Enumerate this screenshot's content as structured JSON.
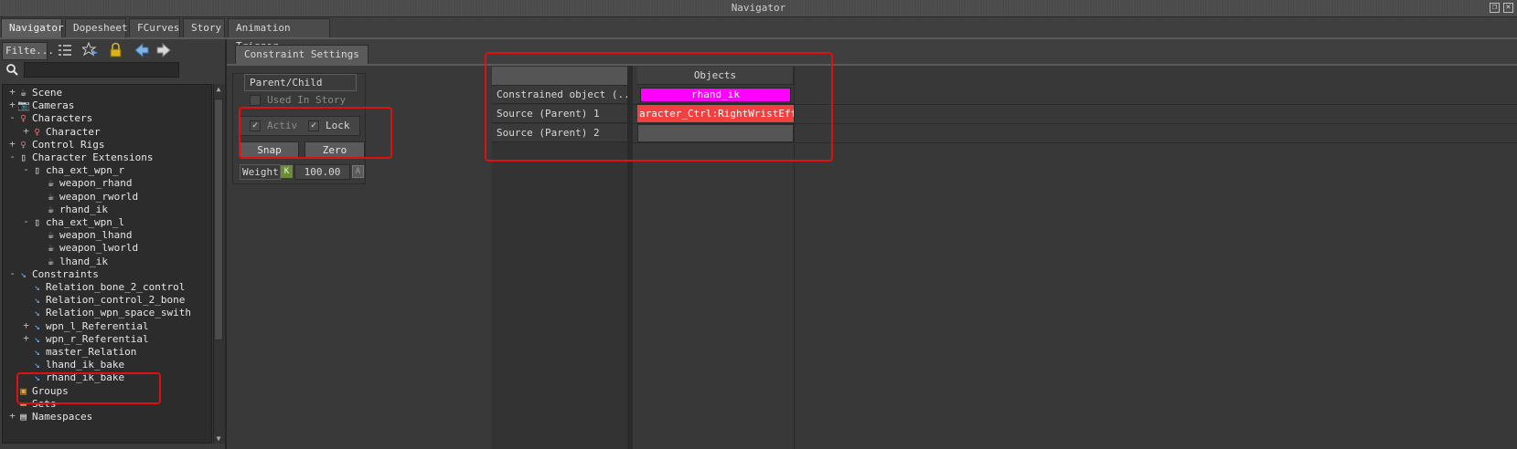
{
  "window": {
    "title": "Navigator"
  },
  "tabs": [
    "Navigator",
    "Dopesheet",
    "FCurves",
    "Story",
    "Animation Trigger"
  ],
  "navigator": {
    "filter_label": "Filte...",
    "search_value": "",
    "tree": [
      {
        "label": "Scene",
        "exp": "+",
        "icon": "scene-icon"
      },
      {
        "label": "Cameras",
        "exp": "+",
        "icon": "camera-icon"
      },
      {
        "label": "Characters",
        "exp": "-",
        "icon": "character-icon"
      },
      {
        "label": "Character",
        "exp": "+",
        "icon": "character-icon"
      },
      {
        "label": "Control Rigs",
        "exp": "+",
        "icon": "control-rig-icon"
      },
      {
        "label": "Character Extensions",
        "exp": "-",
        "icon": "character-extension-icon"
      },
      {
        "label": "cha_ext_wpn_r",
        "exp": "-",
        "icon": "character-extension-icon"
      },
      {
        "label": "weapon_rhand",
        "exp": "",
        "icon": "null-object-icon"
      },
      {
        "label": "weapon_rworld",
        "exp": "",
        "icon": "null-object-icon"
      },
      {
        "label": "rhand_ik",
        "exp": "",
        "icon": "null-object-icon"
      },
      {
        "label": "cha_ext_wpn_l",
        "exp": "-",
        "icon": "character-extension-icon"
      },
      {
        "label": "weapon_lhand",
        "exp": "",
        "icon": "null-object-icon"
      },
      {
        "label": "weapon_lworld",
        "exp": "",
        "icon": "null-object-icon"
      },
      {
        "label": "lhand_ik",
        "exp": "",
        "icon": "null-object-icon"
      },
      {
        "label": "Constraints",
        "exp": "-",
        "icon": "constraint-icon"
      },
      {
        "label": "Relation_bone_2_control",
        "exp": "",
        "icon": "constraint-icon"
      },
      {
        "label": "Relation_control_2_bone",
        "exp": "",
        "icon": "constraint-icon"
      },
      {
        "label": "Relation_wpn_space_swith",
        "exp": "",
        "icon": "constraint-icon"
      },
      {
        "label": "wpn_l_Referential",
        "exp": "+",
        "icon": "constraint-icon"
      },
      {
        "label": "wpn_r_Referential",
        "exp": "+",
        "icon": "constraint-icon"
      },
      {
        "label": "master_Relation",
        "exp": "",
        "icon": "constraint-icon"
      },
      {
        "label": "lhand_ik_bake",
        "exp": "",
        "icon": "constraint-icon"
      },
      {
        "label": "rhand_ik_bake",
        "exp": "",
        "icon": "constraint-icon"
      },
      {
        "label": "Groups",
        "exp": "",
        "icon": "groups-icon"
      },
      {
        "label": "Sets",
        "exp": "",
        "icon": "sets-icon"
      },
      {
        "label": "Namespaces",
        "exp": "+",
        "icon": "namespace-icon"
      }
    ]
  },
  "constraint_settings": {
    "tab_label": "Constraint Settings",
    "type_label": "Parent/Child",
    "used_in_story_label": "Used In Story",
    "activ_label": "Activ",
    "lock_label": "Lock",
    "snap_label": "Snap",
    "zero_label": "Zero",
    "weight_label": "Weight",
    "weight_key": "K",
    "weight_value": "100.00",
    "weight_anim_btn": "A"
  },
  "sheet": {
    "header": "Objects",
    "rows": [
      {
        "name": "Constrained object (...",
        "value": "rhand_ik",
        "color": "#ff00ff"
      },
      {
        "name": "Source (Parent) 1",
        "value": "aracter_Ctrl:RightWristEffect",
        "color": "#f04040"
      },
      {
        "name": "Source (Parent) 2",
        "value": "",
        "color": ""
      }
    ]
  }
}
